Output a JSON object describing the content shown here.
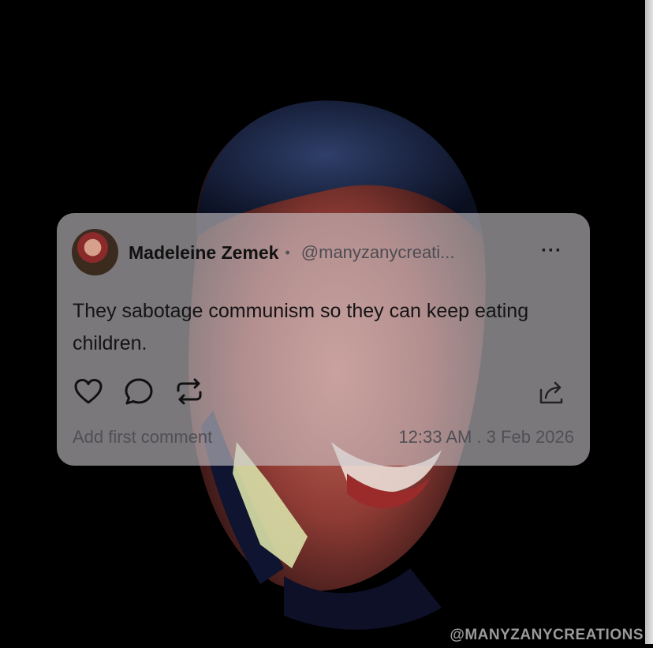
{
  "post": {
    "author_name": "Madeleine Zemek",
    "separator": "•",
    "author_handle": "@manyzanycreati...",
    "more_label": "···",
    "text": "They sabotage communism so they can keep eating children.",
    "comment_prompt": "Add first comment",
    "timestamp": "12:33 AM . 3 Feb 2026",
    "icons": {
      "like": "heart-icon",
      "comment": "comment-bubble-icon",
      "repost": "repost-icon",
      "share": "share-icon"
    }
  },
  "watermark": "@MANYZANYCREATIONS",
  "colors": {
    "background": "#000000",
    "card": "#cdc8cd",
    "text": "#141414",
    "muted": "#4f4f55"
  }
}
